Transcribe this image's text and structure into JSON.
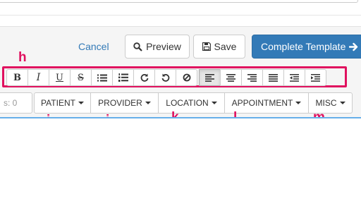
{
  "header": {
    "cancel_label": "Cancel",
    "preview_label": "Preview",
    "save_label": "Save",
    "complete_label": "Complete Template"
  },
  "annotations": {
    "toolbar": "h",
    "patient": "i",
    "provider": "j",
    "location": "k",
    "appointment": "l",
    "misc": "m"
  },
  "toolbar": {
    "bold": "B",
    "italic": "I",
    "underline": "U",
    "strike": "S",
    "active_alignment": "align-left"
  },
  "counter": {
    "text": "s: 0"
  },
  "fields": {
    "patient": "PATIENT",
    "provider": "PROVIDER",
    "location": "LOCATION",
    "appointment": "APPOINTMENT",
    "misc": "MISC"
  },
  "colors": {
    "primary": "#337ab7",
    "annotation": "#e0115f",
    "focus": "#66afe9"
  }
}
